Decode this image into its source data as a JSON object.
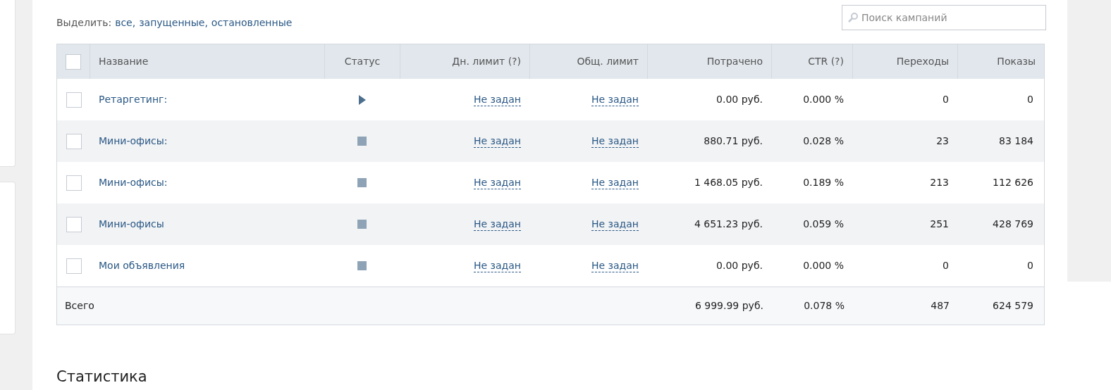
{
  "select_bar": {
    "label": "Выделить:",
    "links": [
      "все,",
      "запущенные,",
      "остановленные"
    ]
  },
  "search": {
    "placeholder": "Поиск кампаний"
  },
  "table": {
    "columns": [
      "Название",
      "Статус",
      "Дн. лимит (?)",
      "Общ. лимит",
      "Потрачено",
      "CTR (?)",
      "Переходы",
      "Показы"
    ],
    "header_checked": false,
    "rows": [
      {
        "checked": false,
        "name": "Ретаргетинг:",
        "running": true,
        "day_limit": "Не задан",
        "total_limit": "Не задан",
        "spent": "0.00 руб.",
        "ctr": "0.000 %",
        "clicks": "0",
        "views": "0"
      },
      {
        "checked": false,
        "name": "Мини-офисы:",
        "running": false,
        "day_limit": "Не задан",
        "total_limit": "Не задан",
        "spent": "880.71 руб.",
        "ctr": "0.028 %",
        "clicks": "23",
        "views": "83 184"
      },
      {
        "checked": false,
        "name": "Мини-офисы:",
        "running": false,
        "day_limit": "Не задан",
        "total_limit": "Не задан",
        "spent": "1 468.05 руб.",
        "ctr": "0.189 %",
        "clicks": "213",
        "views": "112 626"
      },
      {
        "checked": false,
        "name": "Мини-офисы",
        "running": false,
        "day_limit": "Не задан",
        "total_limit": "Не задан",
        "spent": "4 651.23 руб.",
        "ctr": "0.059 %",
        "clicks": "251",
        "views": "428 769"
      },
      {
        "checked": false,
        "name": "Мои объявления",
        "running": false,
        "day_limit": "Не задан",
        "total_limit": "Не задан",
        "spent": "0.00 руб.",
        "ctr": "0.000 %",
        "clicks": "0",
        "views": "0"
      }
    ],
    "total": {
      "label": "Всего",
      "spent": "6 999.99 руб.",
      "ctr": "0.078 %",
      "clicks": "487",
      "views": "624 579"
    }
  },
  "section_title": "Статистика"
}
